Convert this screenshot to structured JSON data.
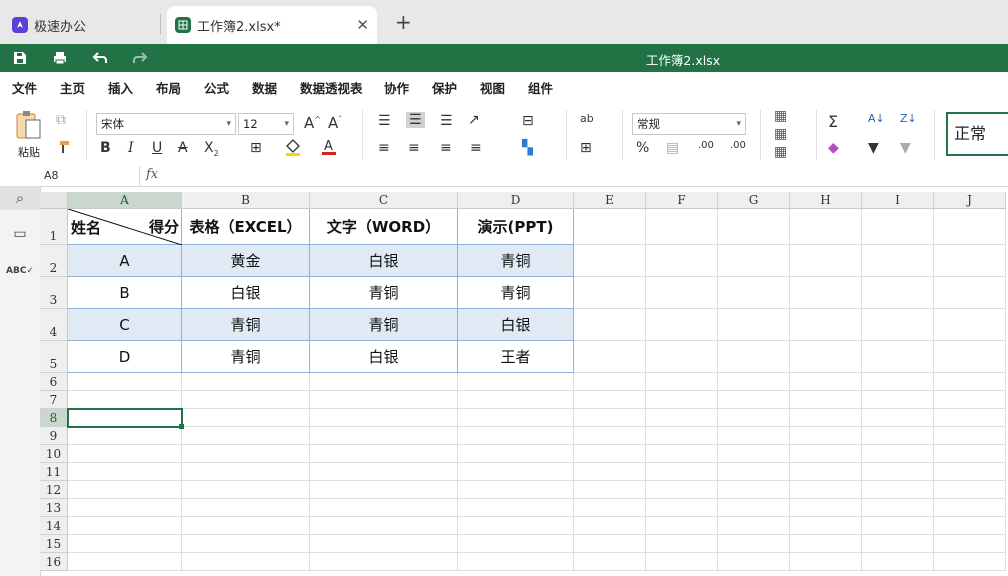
{
  "tabs": [
    {
      "label": "极速办公",
      "icon": "rocket-icon",
      "color": "#5b3fd9"
    },
    {
      "label": "工作簿2.xlsx*",
      "icon": "spreadsheet-icon",
      "color": "#217346"
    }
  ],
  "title_bar": {
    "document_title": "工作簿2.xlsx",
    "color": "#217346"
  },
  "menu": [
    "文件",
    "主页",
    "插入",
    "布局",
    "公式",
    "数据",
    "数据透视表",
    "协作",
    "保护",
    "视图",
    "组件"
  ],
  "menu_active": "主页",
  "ribbon": {
    "paste_label": "粘贴",
    "font_name": "宋体",
    "font_size": "12",
    "number_format": "常规",
    "cell_style": "正常"
  },
  "formula_bar": {
    "name_box": "A8",
    "fx": "fx",
    "formula": ""
  },
  "columns": [
    "A",
    "B",
    "C",
    "D",
    "E",
    "F",
    "G",
    "H",
    "I",
    "J"
  ],
  "rows": [
    "1",
    "2",
    "3",
    "4",
    "5",
    "6",
    "7",
    "8",
    "9",
    "10",
    "11",
    "12",
    "13",
    "14",
    "15",
    "16"
  ],
  "selected_cell": "A8",
  "table": {
    "corner_top": "得分",
    "corner_bottom": "姓名",
    "headers": [
      "表格（EXCEL）",
      "文字（WORD）",
      "演示(PPT)"
    ],
    "rows": [
      {
        "name": "A",
        "values": [
          "黄金",
          "白银",
          "青铜"
        ]
      },
      {
        "name": "B",
        "values": [
          "白银",
          "青铜",
          "青铜"
        ]
      },
      {
        "name": "C",
        "values": [
          "青铜",
          "青铜",
          "白银"
        ]
      },
      {
        "name": "D",
        "values": [
          "青铜",
          "白银",
          "王者"
        ]
      }
    ]
  }
}
